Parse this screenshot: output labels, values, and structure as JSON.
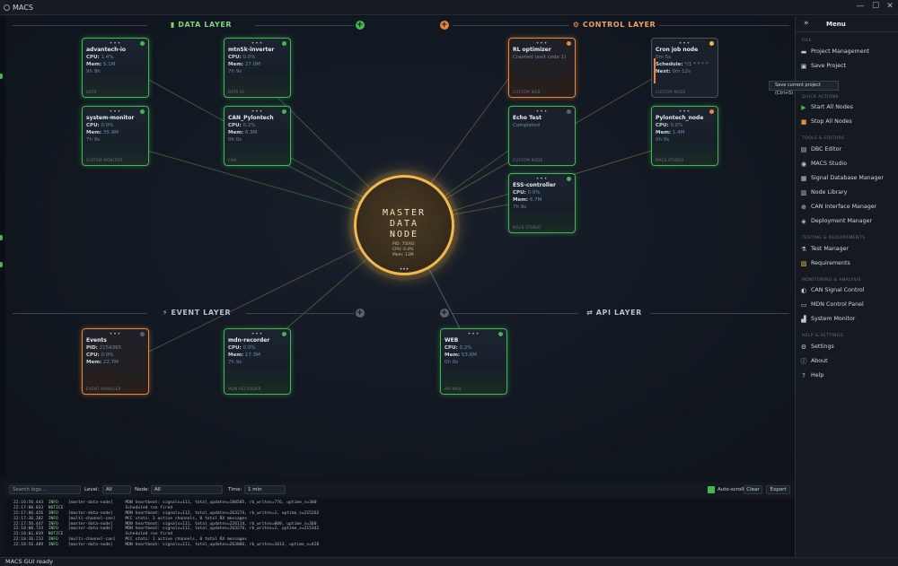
{
  "window": {
    "title": "MACS",
    "minimize": "—",
    "maximize": "☐",
    "close": "✕"
  },
  "layers": {
    "data": {
      "title": "DATA LAYER",
      "icon": "▮",
      "btn": "+"
    },
    "control": {
      "title": "CONTROL LAYER",
      "icon": "⚙",
      "btn": "+"
    },
    "event": {
      "title": "EVENT LAYER",
      "icon": "⚡",
      "btn": "+"
    },
    "api": {
      "title": "API LAYER",
      "icon": "⇄",
      "btn": "+"
    }
  },
  "nodes": {
    "advantech": {
      "name": "advantech-io",
      "k1": "CPU:",
      "v1": "1.4%",
      "k2": "Mem:",
      "v2": "5.1M",
      "v3": "9h 9h",
      "bt": "DATA"
    },
    "mtnsk": {
      "name": "mtnSk-inverter",
      "k1": "CPU:",
      "v1": "0.0%",
      "k2": "Mem:",
      "v2": "27.0M",
      "v3": "7h 9s",
      "bt": "DATA IO"
    },
    "sysmon": {
      "name": "system-monitor",
      "k1": "CPU:",
      "v1": "0.0%",
      "k2": "Mem:",
      "v2": "35.9M",
      "v3": "7h 9s",
      "bt": "SYSTEM MONITOR"
    },
    "canpylon": {
      "name": "CAN_Pylontech",
      "k1": "CPU:",
      "v1": "0.2%",
      "k2": "Mem:",
      "v2": "6.3M",
      "v3": "0h 0s",
      "bt": "CAN"
    },
    "rlopt": {
      "name": "RL optimizer",
      "k1": "",
      "v1": "Crashed (exit code 1)",
      "bt": "CUSTOM WEB"
    },
    "cron": {
      "name": "Cron job node",
      "l1": "0m 5s",
      "k2": "Schedule:",
      "v2": "*/1 * * * *",
      "k3": "Next:",
      "v3": "0m 12s",
      "bt": "CUSTOM NODE"
    },
    "echo": {
      "name": "Echo Test",
      "v1": "Completed",
      "bt": "CUSTOM NODE"
    },
    "pylonnode": {
      "name": "Pylontech_node",
      "k1": "CPU:",
      "v1": "0.0%",
      "k2": "Mem:",
      "v2": "1.4M",
      "v3": "0h 0s",
      "bt": "MACS STUDIO"
    },
    "ess": {
      "name": "ESS-controller",
      "k1": "CPU:",
      "v1": "0.0%",
      "k2": "Mem:",
      "v2": "6.7M",
      "v3": "7h 9s",
      "bt": "MACS STUDIO"
    },
    "events": {
      "name": "Events",
      "k0": "PID:",
      "v0": "2154365",
      "k1": "CPU:",
      "v1": "0.0%",
      "k2": "Mem:",
      "v2": "22.7M",
      "bt": "EVENT MANAGER"
    },
    "mdnrec": {
      "name": "mdn-recorder",
      "k1": "CPU:",
      "v1": "0.0%",
      "k2": "Mem:",
      "v2": "17.3M",
      "v3": "7h 9s",
      "bt": "MDN RECORDER"
    },
    "web": {
      "name": "WEB",
      "k1": "CPU:",
      "v1": "0.2%",
      "k2": "Mem:",
      "v2": "53.6M",
      "v3": "0h 0s",
      "bt": "API WEB"
    }
  },
  "master": {
    "l1": "MASTER",
    "l2": "DATA",
    "l3": "NODE",
    "pid": "PID: 75092",
    "cpu": "CPU: 0.4%",
    "mem": "Mem: 13M",
    "dots": "•••"
  },
  "menu": {
    "title": "Menu",
    "collapse": "»",
    "sections": {
      "file": "FILE",
      "quick": "QUICK ACTIONS",
      "tools": "TOOLS & EDITORS",
      "testing": "TESTING & REQUIREMENTS",
      "monitoring": "MONITORING & ANALYSIS",
      "help": "HELP & SETTINGS"
    },
    "items": {
      "project_management": "Project Management",
      "save_project": "Save Project",
      "start_all": "Start All Nodes",
      "stop_all": "Stop All Nodes",
      "dbc_editor": "DBC Editor",
      "macs_studio": "MACS Studio",
      "signal_db": "Signal Database Manager",
      "node_library": "Node Library",
      "can_iface": "CAN Interface Manager",
      "deployment": "Deployment Manager",
      "test_manager": "Test Manager",
      "requirements": "Requirements",
      "can_signal": "CAN Signal Control",
      "mdn_panel": "MDN Control Panel",
      "sys_monitor": "System Monitor",
      "settings": "Settings",
      "about": "About",
      "help": "Help"
    },
    "tooltip": "Save current project (Ctrl+S)"
  },
  "logbar": {
    "search_placeholder": "Search logs...",
    "level_label": "Level:",
    "level_value": "All",
    "node_label": "Node:",
    "node_value": "All",
    "time_label": "Time:",
    "time_value": "1 min",
    "autoscroll": "Auto-scroll",
    "clear": "Clear",
    "export": "Export"
  },
  "logs": [
    {
      "t": "22:16:56.443",
      "lv": "INFO",
      "src": "[master-data-node]",
      "msg": "MDN heartbeat: signals=111, total_updates=180505, rb_writes=776, uptime_s=300"
    },
    {
      "t": "22:17:00.033",
      "lv": "NOTICE",
      "src": "",
      "msg": "Scheduled run fired"
    },
    {
      "t": "22:17:06.426",
      "lv": "INFO",
      "src": "[master-data-node]",
      "msg": "MDN heartbeat: signals=112, total_updates=263274, rb_writes=2, uptime_s=215262"
    },
    {
      "t": "22:17:36.202",
      "lv": "INFO",
      "src": "[multi-channel-can]",
      "msg": "MCC stats: 1 active channels, 0 total RX messages"
    },
    {
      "t": "22:17:56.447",
      "lv": "INFO",
      "src": "[master-data-node]",
      "msg": "MDN heartbeat: signals=111, total_updates=226114, rb_writes=809, uptime_s=360"
    },
    {
      "t": "22:18:00.724",
      "lv": "INFO",
      "src": "[master-data-node]",
      "msg": "MDN heartbeat: signals=112, total_updates=263276, rb_writes=2, uptime_s=215342"
    },
    {
      "t": "22:18:01.039",
      "lv": "NOTICE",
      "src": "",
      "msg": "Scheduled run fired"
    },
    {
      "t": "22:18:36.213",
      "lv": "INFO",
      "src": "[multi-channel-can]",
      "msg": "MCC stats: 1 active channels, 0 total RX messages"
    },
    {
      "t": "22:18:56.489",
      "lv": "INFO",
      "src": "[master-data-node]",
      "msg": "MDN heartbeat: signals=111, total_updates=263886, rb_writes=1013, uptime_s=420"
    }
  ],
  "status": "MACS GUI ready",
  "colors": {
    "accent_green": "#3fb950",
    "accent_orange": "#e8873a",
    "master_gold": "#f2b84a"
  }
}
